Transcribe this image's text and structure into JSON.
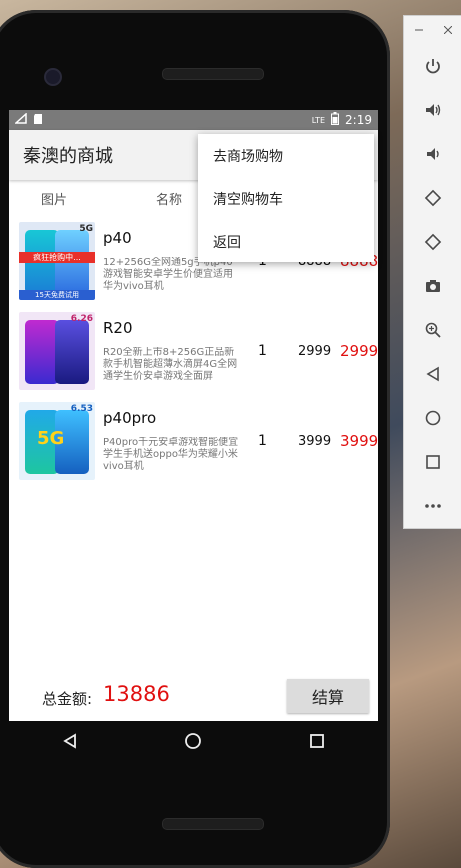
{
  "status_bar": {
    "time": "2:19",
    "lte": "LTE"
  },
  "app_bar": {
    "title": "秦澳的商城"
  },
  "columns": {
    "image": "图片",
    "name": "名称"
  },
  "overflow_menu": {
    "items": [
      "去商场购物",
      "清空购物车",
      "返回"
    ]
  },
  "items": [
    {
      "name": "p40",
      "desc": "12+256G全网通5g手机p40游戏智能安卓学生价便宜适用华为vivo耳机",
      "qty": "1",
      "price": "8888",
      "total": "8888",
      "thumb": {
        "bg": "#dfe8f5",
        "phone": "#18c7d6",
        "badge": "5G",
        "badge_color": "#2a2a2a",
        "banner": "疯狂抢购中...",
        "footer": "15天免费试用"
      }
    },
    {
      "name": "R20",
      "desc": "R20全新上市8+256G正品新款手机智能超薄水滴屏4G全网通学生价安卓游戏全面屏",
      "qty": "1",
      "price": "2999",
      "total": "2999",
      "thumb": {
        "bg": "#f1e6f6",
        "phone": "#4a3fd0",
        "badge": "6.26",
        "badge_color": "#c0246a"
      }
    },
    {
      "name": "p40pro",
      "desc": "P40pro千元安卓游戏智能便宜学生手机送oppo华为荣耀小米vivo耳机",
      "qty": "1",
      "price": "3999",
      "total": "3999",
      "thumb": {
        "bg": "#e6f2fb",
        "phone": "#21a9e8",
        "badge": "6.53",
        "badge_color": "#1560c0",
        "banner": "5G"
      }
    }
  ],
  "footer": {
    "label": "总金额:",
    "amount": "13886",
    "checkout": "结算"
  },
  "colors": {
    "accent": "#e01010"
  }
}
